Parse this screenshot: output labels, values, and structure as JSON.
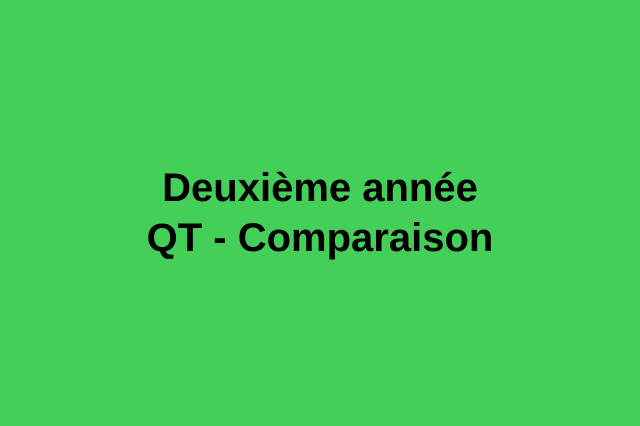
{
  "slide": {
    "background_color": "#44cf59",
    "text_color": "#000000",
    "title_lines": [
      "Deuxième année",
      "QT - Comparaison"
    ]
  }
}
